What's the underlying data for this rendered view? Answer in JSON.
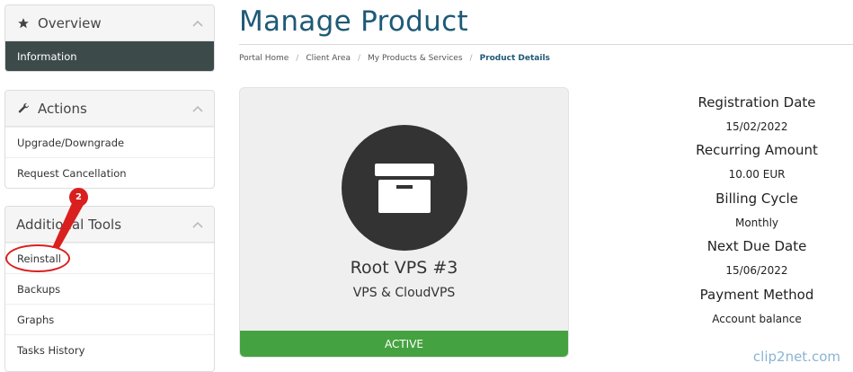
{
  "sidebar": {
    "overview": {
      "title": "Overview",
      "items": [
        {
          "label": "Information"
        }
      ]
    },
    "actions": {
      "title": "Actions",
      "items": [
        {
          "label": "Upgrade/Downgrade"
        },
        {
          "label": "Request Cancellation"
        }
      ]
    },
    "tools": {
      "title": "Additional Tools",
      "items": [
        {
          "label": "Reinstall"
        },
        {
          "label": "Backups"
        },
        {
          "label": "Graphs"
        },
        {
          "label": "Tasks History"
        }
      ]
    }
  },
  "page": {
    "title": "Manage Product"
  },
  "breadcrumb": [
    "Portal Home",
    "Client Area",
    "My Products & Services",
    "Product Details"
  ],
  "product": {
    "name": "Root VPS #3",
    "group": "VPS & CloudVPS",
    "status": "ACTIVE",
    "status_color": "#45a240"
  },
  "details": [
    {
      "label": "Registration Date",
      "value": "15/02/2022"
    },
    {
      "label": "Recurring Amount",
      "value": "10.00 EUR"
    },
    {
      "label": "Billing Cycle",
      "value": "Monthly"
    },
    {
      "label": "Next Due Date",
      "value": "15/06/2022"
    },
    {
      "label": "Payment Method",
      "value": "Account balance"
    }
  ],
  "annotation": {
    "step": "2"
  },
  "watermark": "clip2net.com"
}
